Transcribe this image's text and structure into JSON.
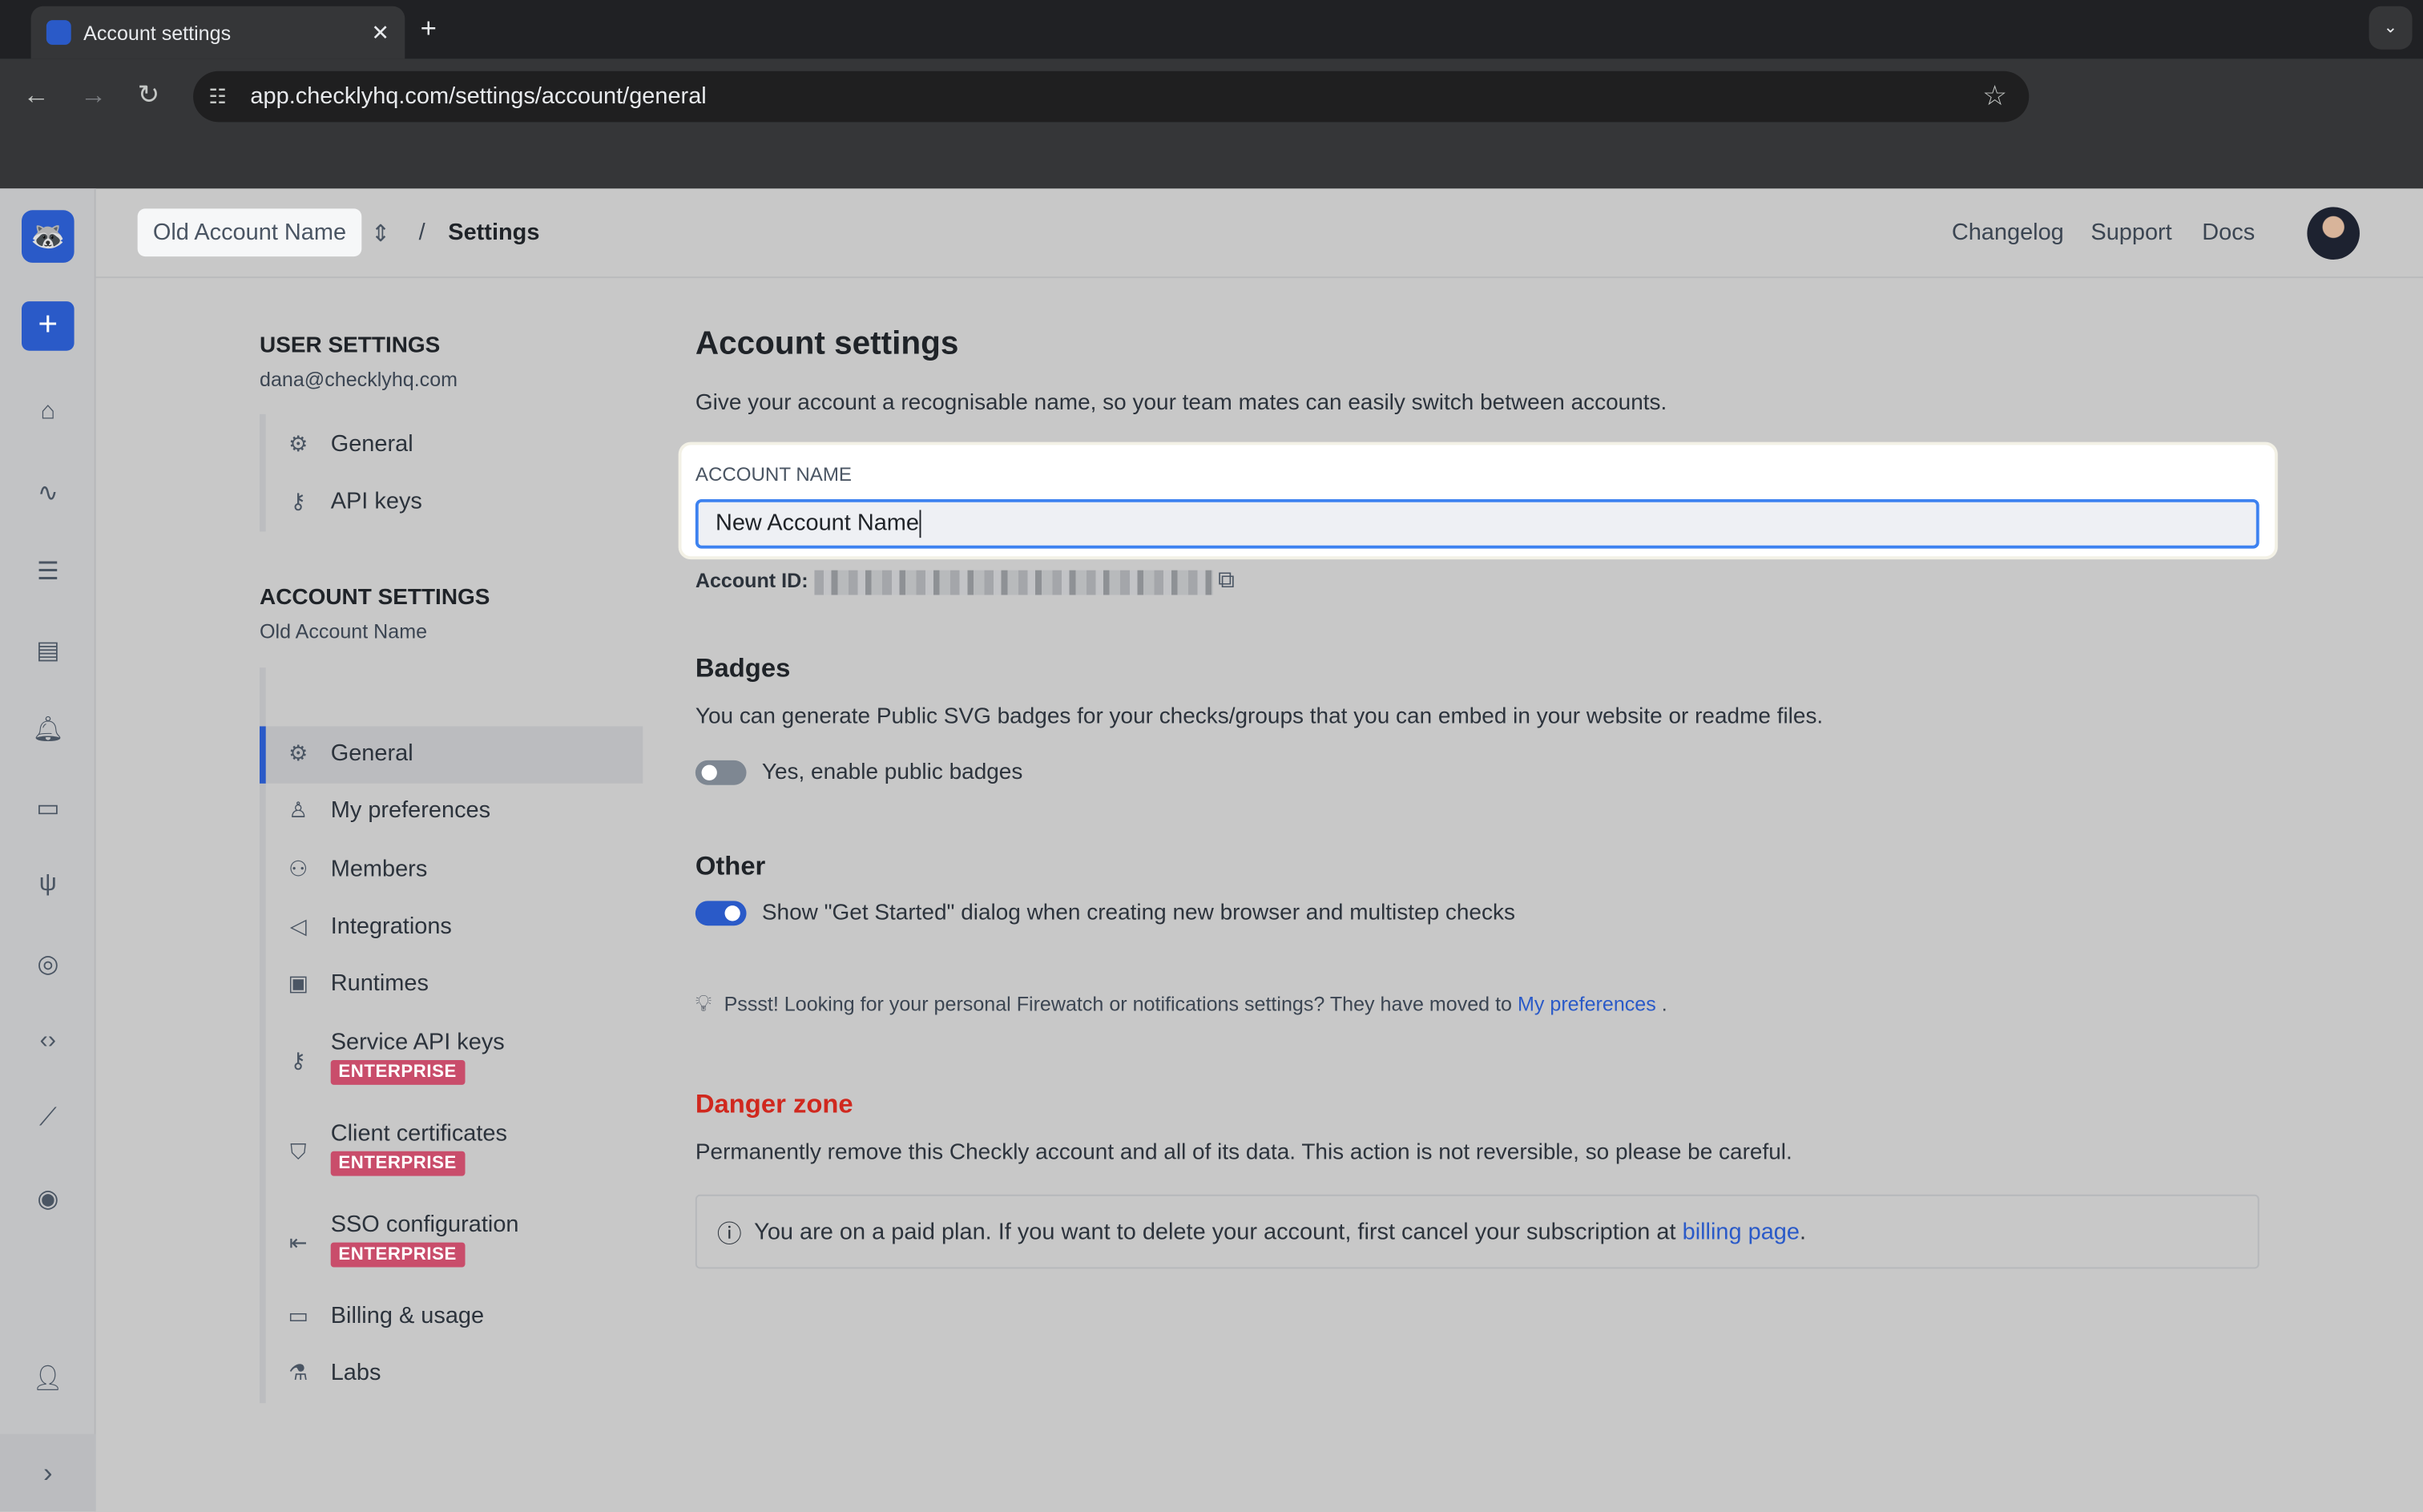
{
  "browser": {
    "tab_title": "Account settings",
    "url": "app.checklyhq.com/settings/account/general"
  },
  "header": {
    "account_switcher": "Old Account Name",
    "separator": "/",
    "page": "Settings",
    "links": [
      "Changelog",
      "Support",
      "Docs"
    ]
  },
  "sidebar_nav": {
    "user_heading": "USER SETTINGS",
    "user_email": "dana@checklyhq.com",
    "user_items": [
      {
        "label": "General",
        "icon": "gear-icon"
      },
      {
        "label": "API keys",
        "icon": "key-icon"
      }
    ],
    "account_heading": "ACCOUNT SETTINGS",
    "account_name": "Old Account Name",
    "account_items": [
      {
        "label": "General",
        "icon": "gear-icon",
        "active": true
      },
      {
        "label": "My preferences",
        "icon": "user-icon"
      },
      {
        "label": "Members",
        "icon": "users-icon"
      },
      {
        "label": "Integrations",
        "icon": "megaphone-icon"
      },
      {
        "label": "Runtimes",
        "icon": "chip-icon"
      },
      {
        "label": "Service API keys",
        "icon": "key-icon",
        "badge": "ENTERPRISE"
      },
      {
        "label": "Client certificates",
        "icon": "shield-icon",
        "badge": "ENTERPRISE"
      },
      {
        "label": "SSO configuration",
        "icon": "login-icon",
        "badge": "ENTERPRISE"
      },
      {
        "label": "Billing & usage",
        "icon": "credit-card-icon"
      },
      {
        "label": "Labs",
        "icon": "flask-icon"
      }
    ]
  },
  "main": {
    "title": "Account settings",
    "intro": "Give your account a recognisable name, so your team mates can easily switch between accounts.",
    "account_name_label": "ACCOUNT NAME",
    "account_name_value": "New Account Name",
    "account_id_label": "Account ID:",
    "badges_title": "Badges",
    "badges_text": "You can generate Public SVG badges for your checks/groups that you can embed in your website or readme files.",
    "badges_toggle": "Yes, enable public badges",
    "badges_enabled": false,
    "other_title": "Other",
    "other_toggle": "Show \"Get Started\" dialog when creating new browser and multistep checks",
    "other_enabled": true,
    "tip_text": "Pssst! Looking for your personal Firewatch or notifications settings? They have moved to",
    "tip_link": "My preferences",
    "tip_end": ".",
    "danger_title": "Danger zone",
    "danger_text": "Permanently remove this Checkly account and all of its data. This action is not reversible, so please be careful.",
    "notice_text": "You are on a paid plan. If you want to delete your account, first cancel your subscription at",
    "notice_link": "billing page",
    "notice_end": "."
  },
  "colors": {
    "accent": "#2a5ac8",
    "danger": "#d0281e",
    "enterprise": "#c94d6b"
  }
}
